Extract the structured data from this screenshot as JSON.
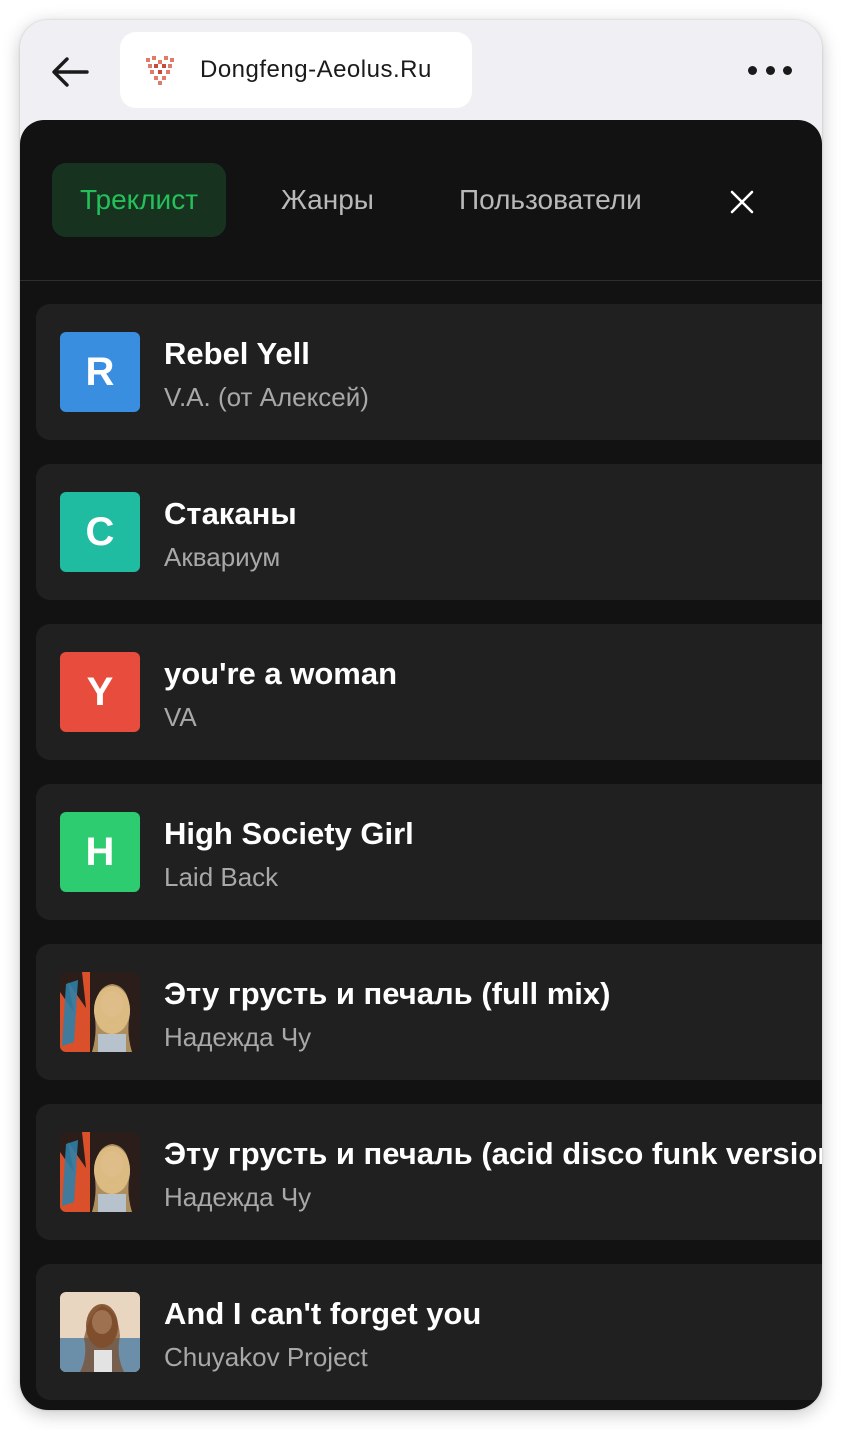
{
  "site": {
    "title": "Dongfeng-Aeolus.Ru",
    "logo_icon": "heart-pattern-logo"
  },
  "tabs": [
    {
      "label": "Треклист",
      "active": true
    },
    {
      "label": "Жанры",
      "active": false
    },
    {
      "label": "Пользователи",
      "active": false
    }
  ],
  "colors": {
    "accent_green": "#24c15a",
    "panel_bg": "#121212",
    "card_bg": "#202020"
  },
  "tracks": [
    {
      "initial": "R",
      "title": "Rebel Yell",
      "artist": "V.A. (от Алексей)",
      "cover_color": "#3a8ee0",
      "cover_type": "letter"
    },
    {
      "initial": "С",
      "title": "Стаканы",
      "artist": "Аквариум",
      "cover_color": "#1fbca1",
      "cover_type": "letter"
    },
    {
      "initial": "Y",
      "title": "you're a woman",
      "artist": "VA",
      "cover_color": "#e74c3c",
      "cover_type": "letter"
    },
    {
      "initial": "H",
      "title": "High Society Girl",
      "artist": "Laid Back",
      "cover_color": "#2ecc71",
      "cover_type": "letter"
    },
    {
      "initial": "",
      "title": "Эту грусть и печаль (full mix)",
      "artist": "Надежда Чу",
      "cover_color": "#3a2a22",
      "cover_type": "photo"
    },
    {
      "initial": "",
      "title": "Эту грусть и печаль (acid disco funk version)",
      "artist": "Надежда Чу",
      "cover_color": "#3a2a22",
      "cover_type": "photo"
    },
    {
      "initial": "",
      "title": "And I can't forget you",
      "artist": "Chuyakov Project",
      "cover_color": "#c9a27a",
      "cover_type": "photo-beach"
    }
  ]
}
